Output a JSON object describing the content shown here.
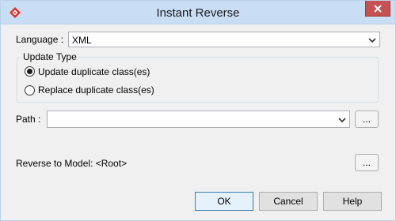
{
  "window": {
    "title": "Instant Reverse",
    "app_icon": "visual-paradigm-icon",
    "close_icon": "close-icon"
  },
  "language": {
    "label": "Language :",
    "value": "XML"
  },
  "update_type": {
    "legend": "Update Type",
    "options": [
      {
        "label": "Update duplicate class(es)",
        "checked": true
      },
      {
        "label": "Replace duplicate class(es)",
        "checked": false
      }
    ]
  },
  "path": {
    "label": "Path :",
    "value": "",
    "browse_label": "..."
  },
  "reverse_model": {
    "label": "Reverse to Model: <Root>",
    "browse_label": "..."
  },
  "buttons": {
    "ok": "OK",
    "cancel": "Cancel",
    "help": "Help"
  },
  "colors": {
    "titlebar": "#c9def5",
    "close": "#c75050",
    "brand": "#d9312b"
  }
}
